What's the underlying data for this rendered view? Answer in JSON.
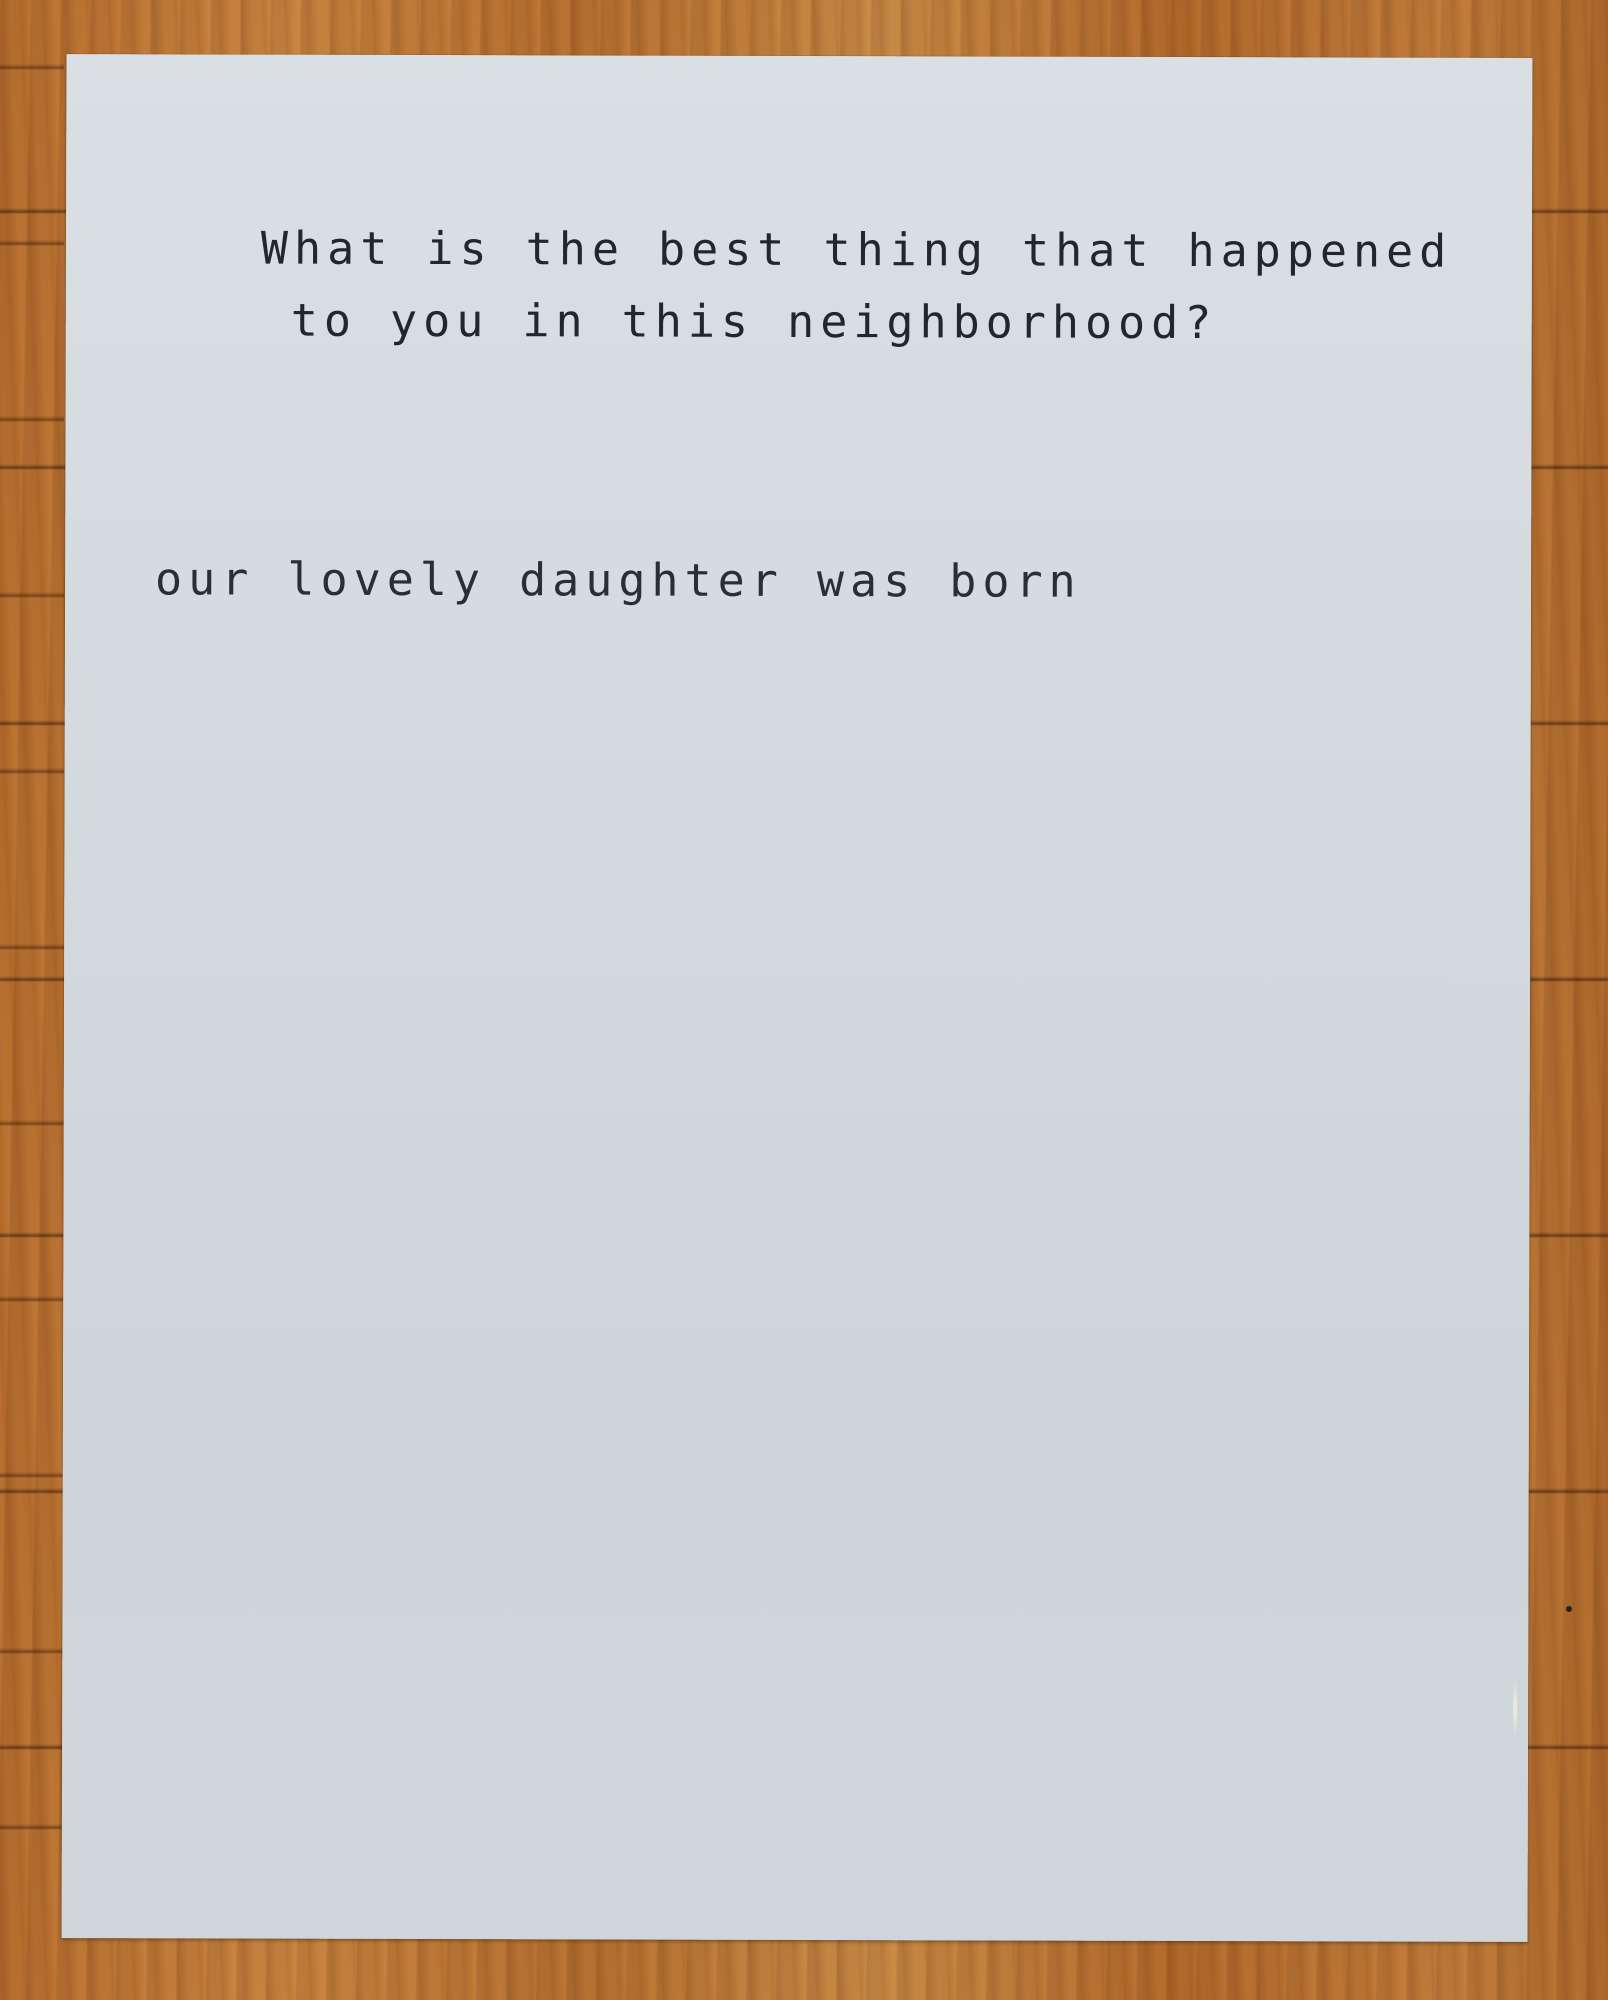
{
  "question": {
    "lines": [
      "What is the best thing that happened",
      "to you in this neighborhood?"
    ]
  },
  "answer": {
    "text": "our lovely daughter was born"
  },
  "colors": {
    "paper": "#d3dade",
    "wood": "#c27c3a",
    "ink": "#23272b"
  }
}
